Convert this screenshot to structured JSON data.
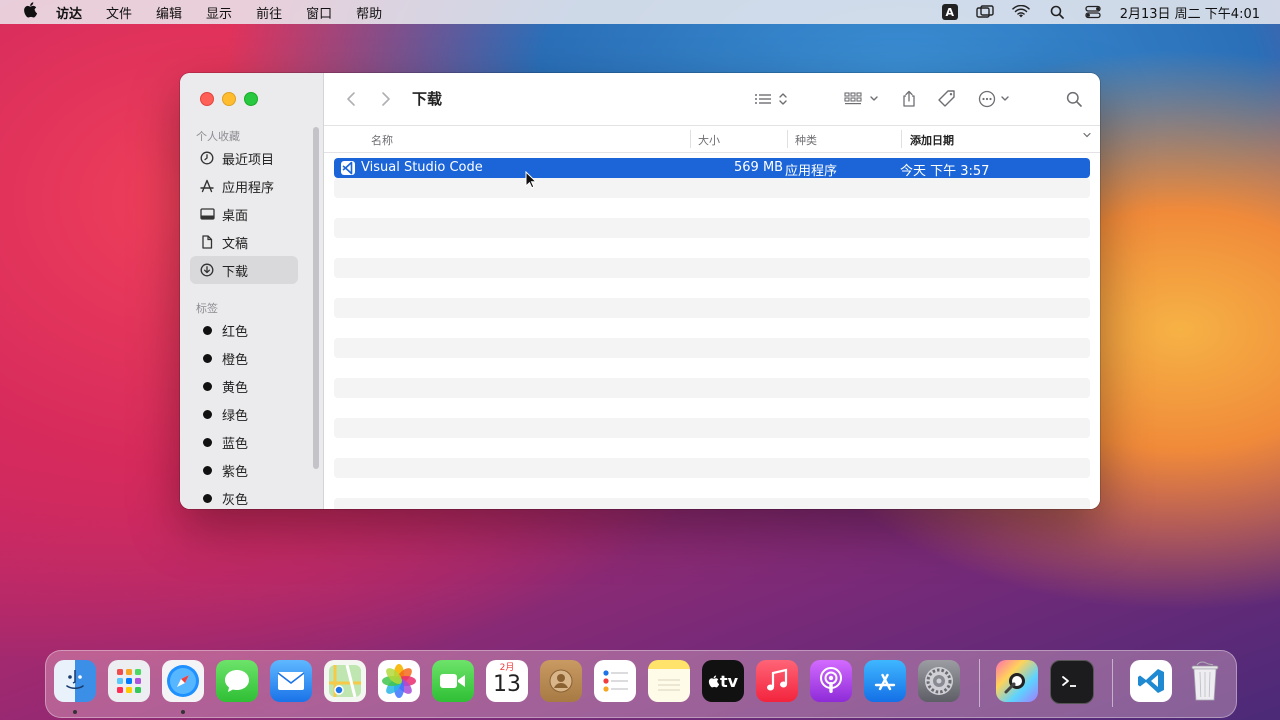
{
  "menubar": {
    "items": [
      "访达",
      "文件",
      "编辑",
      "显示",
      "前往",
      "窗口",
      "帮助"
    ],
    "ime_label": "A",
    "clock": "2月13日 周二 下午4:01"
  },
  "window": {
    "title": "下载",
    "sidebar": {
      "favorites_header": "个人收藏",
      "favorites": [
        {
          "label": "最近项目",
          "icon": "clock-icon"
        },
        {
          "label": "应用程序",
          "icon": "applications-icon"
        },
        {
          "label": "桌面",
          "icon": "desktop-icon"
        },
        {
          "label": "文稿",
          "icon": "document-icon"
        },
        {
          "label": "下载",
          "icon": "download-icon",
          "active": true
        }
      ],
      "tags_header": "标签",
      "tags": [
        {
          "label": "红色"
        },
        {
          "label": "橙色"
        },
        {
          "label": "黄色"
        },
        {
          "label": "绿色"
        },
        {
          "label": "蓝色"
        },
        {
          "label": "紫色"
        },
        {
          "label": "灰色"
        }
      ]
    },
    "columns": {
      "name": "名称",
      "size": "大小",
      "kind": "种类",
      "date_added": "添加日期"
    },
    "files": [
      {
        "name": "Visual Studio Code",
        "size": "569 MB",
        "kind": "应用程序",
        "date_added": "今天 下午 3:57",
        "selected": true
      }
    ]
  },
  "dock": {
    "calendar_month": "2月",
    "calendar_day": "13",
    "tv_label": "tv"
  },
  "colors": {
    "selection": "#1b65d8",
    "close": "#fe5f57",
    "minimize": "#febc2e",
    "zoom": "#28c840"
  }
}
